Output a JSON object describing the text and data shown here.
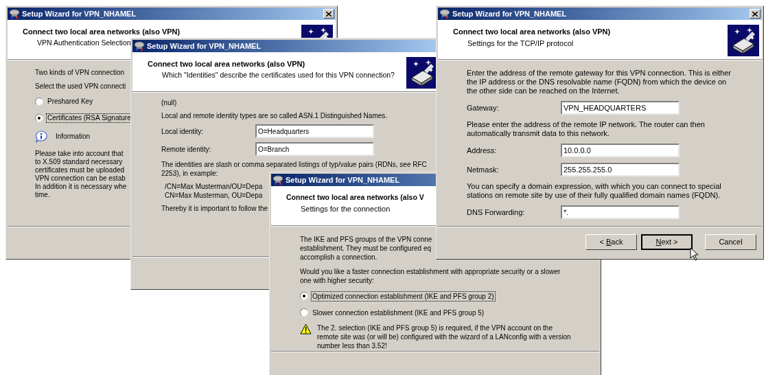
{
  "windows": [
    {
      "title": "Setup Wizard for VPN_NHAMEL",
      "heading": "Connect two local area networks (also VPN)",
      "subtitle": "VPN Authentication Selection",
      "body": [
        {
          "kind": "lines",
          "lines": [
            "Two kinds of VPN connection"
          ]
        },
        {
          "kind": "lines",
          "lines": [
            "Select the used VPN connecti"
          ]
        },
        {
          "kind": "radio",
          "label": "Preshared Key",
          "selected": false,
          "focused": false
        },
        {
          "kind": "radio",
          "label": "Certificates (RSA Signature",
          "selected": true,
          "focused": true
        },
        {
          "kind": "info",
          "label": "Information"
        },
        {
          "kind": "lines",
          "lines": [
            "Please take into account that",
            "to X.509 standard necessary",
            "certificates must be uploaded",
            "VPN connection can be estab",
            "In addition it is necessary whe",
            "time."
          ]
        }
      ]
    },
    {
      "title": "Setup Wizard for VPN_NHAMEL",
      "heading": "Connect two local area networks (also VPN)",
      "subtitle": "Which \"Identities\" describe the certificates used for this VPN connection?",
      "body": [
        {
          "kind": "lines",
          "lines": [
            "(null)"
          ]
        },
        {
          "kind": "lines",
          "lines": [
            "Local and remote identity types are so called ASN.1 Distinguished Names."
          ]
        },
        {
          "kind": "field",
          "label": "Local identity:",
          "value": "O=Headquarters"
        },
        {
          "kind": "field",
          "label": "Remote identity:",
          "value": "O=Branch"
        },
        {
          "kind": "lines",
          "lines": [
            "The identities are slash or comma separated listings of typ/value pairs (RDNs, see RFC",
            "2253), in example:"
          ]
        },
        {
          "kind": "example",
          "lines": [
            "/CN=Max Musterman/OU=Depa",
            "CN=Max Musterman, OU=Depa"
          ]
        },
        {
          "kind": "lines",
          "lines": [
            "Thereby it is important to follow the"
          ]
        }
      ]
    },
    {
      "title": "Setup Wizard for VPN_NHAMEL",
      "heading": "Connect two local area networks (also V",
      "subtitle": "Settings for the connection",
      "body": [
        {
          "kind": "lines",
          "lines": [
            "The IKE and PFS groups of the VPN conne",
            "establishment. They must be configured eq",
            "accomplish a connection."
          ]
        },
        {
          "kind": "paragraph",
          "text": "Would you like a faster connection establishment with appropriate security or a slower one with higher security:"
        },
        {
          "kind": "radio",
          "label": "Optimized connection establishment (IKE and PFS group 2)",
          "selected": true,
          "focused": true
        },
        {
          "kind": "radio",
          "label": "Slower connection establishment (IKE and PFS group 5)",
          "selected": false,
          "focused": false
        },
        {
          "kind": "warning",
          "text": "The 2. selection (IKE and PFS group 5) is required, if the VPN account on the remote site was (or will be) configured with the wizard of a LANconfig with a version number less than 3.52!"
        }
      ]
    },
    {
      "title": "Setup Wizard for VPN_NHAMEL",
      "heading": "Connect two local area networks (also VPN)",
      "subtitle": "Settings for the TCP/IP protocol",
      "body": [
        {
          "kind": "paragraph",
          "text": "Enter the address of the remote gateway for this VPN connection.  This is either the IP address or the DNS resolvable name (FQDN) from which the device on the other side can be reached on the Internet."
        },
        {
          "kind": "field",
          "label": "Gateway:",
          "value": "VPN_HEADQUARTERS"
        },
        {
          "kind": "paragraph",
          "text": "Please enter the address of the remote IP network. The router can then automatically transmit data to this network."
        },
        {
          "kind": "field",
          "label": "Address:",
          "value": "10.0.0.0"
        },
        {
          "kind": "field",
          "label": "Netmask:",
          "value": "255.255.255.0"
        },
        {
          "kind": "paragraph",
          "text": "You can specify a domain expression, with which you can connect to special stations on remote site by use of their fully qualified domain names (FQDN)."
        },
        {
          "kind": "field",
          "label": "DNS Forwarding:",
          "value": "*."
        }
      ],
      "buttons": [
        {
          "before": "< ",
          "mnemonic": "B",
          "after": "ack",
          "default": false
        },
        {
          "mnemonic": "N",
          "after": "ext >",
          "default": true
        },
        {
          "before": "Cancel",
          "default": false
        }
      ]
    }
  ]
}
